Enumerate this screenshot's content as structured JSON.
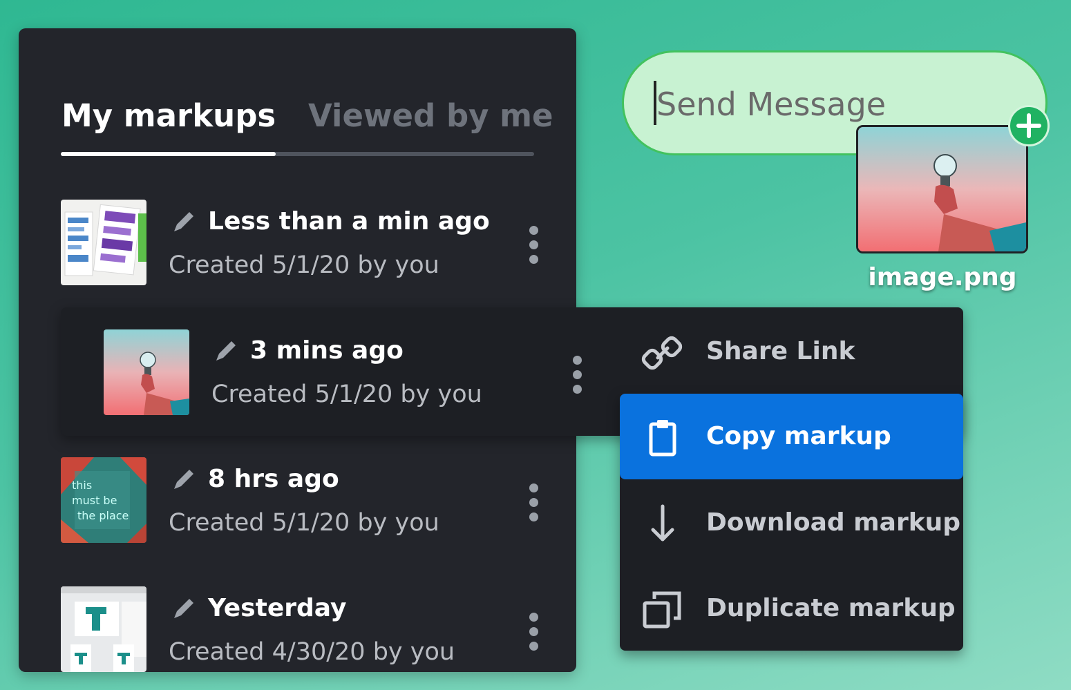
{
  "tabs": {
    "active": "My markups",
    "inactive": "Viewed by me"
  },
  "markups": [
    {
      "title": "Less than a min ago",
      "created": "Created 5/1/20 by you",
      "thumbnail": "notebook-sketch"
    },
    {
      "title": "3 mins ago",
      "created": "Created 5/1/20 by you",
      "thumbnail": "lightbulb-pink-sky"
    },
    {
      "title": "8 hrs ago",
      "created": "Created 5/1/20 by you",
      "thumbnail": "neon-this-must-be-the-place",
      "thumb_text": [
        "this",
        "must be",
        "the place"
      ]
    },
    {
      "title": "Yesterday",
      "created": "Created 4/30/20 by you",
      "thumbnail": "teal-T-pages"
    }
  ],
  "context_menu": {
    "items": [
      {
        "label": "Share Link",
        "icon": "link-icon"
      },
      {
        "label": "Copy markup",
        "icon": "clipboard-icon",
        "selected": true
      },
      {
        "label": "Download markup",
        "icon": "download-icon"
      },
      {
        "label": "Duplicate markup",
        "icon": "duplicate-icon"
      }
    ]
  },
  "message": {
    "placeholder": "Send Message",
    "value": "",
    "attachment": {
      "filename": "image.png",
      "thumbnail": "lightbulb-pink-sky"
    },
    "add_icon": "plus-icon"
  },
  "colors": {
    "panel_bg": "#23252b",
    "active_row_bg": "#1d1f24",
    "menu_selected": "#0a72de",
    "pill_bg": "#c8f2d2",
    "pill_border": "#42c25e",
    "plus_button": "#20b262",
    "muted_text": "#b9bcc2",
    "tab_inactive": "#6e737c"
  }
}
